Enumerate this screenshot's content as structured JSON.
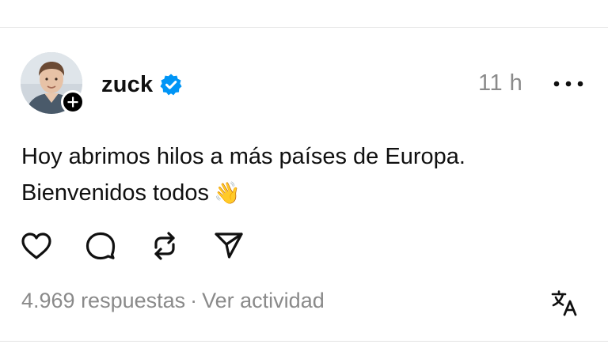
{
  "post": {
    "username": "zuck",
    "timestamp": "11 h",
    "text_line1": "Hoy abrimos hilos a más países de Europa.",
    "text_line2": "Bienvenidos todos",
    "emoji": "👋",
    "replies_label": "4.969 respuestas",
    "separator": "·",
    "activity_label": "Ver actividad"
  },
  "icons": {
    "verified": "verified-badge-icon",
    "more": "more-horizontal-icon",
    "follow": "plus-icon",
    "like": "heart-icon",
    "reply": "comment-icon",
    "repost": "repost-icon",
    "share": "send-icon",
    "translate": "translate-icon"
  },
  "colors": {
    "verified_blue": "#0095f6",
    "muted_text": "#8a8a8a",
    "primary_text": "#101010"
  }
}
